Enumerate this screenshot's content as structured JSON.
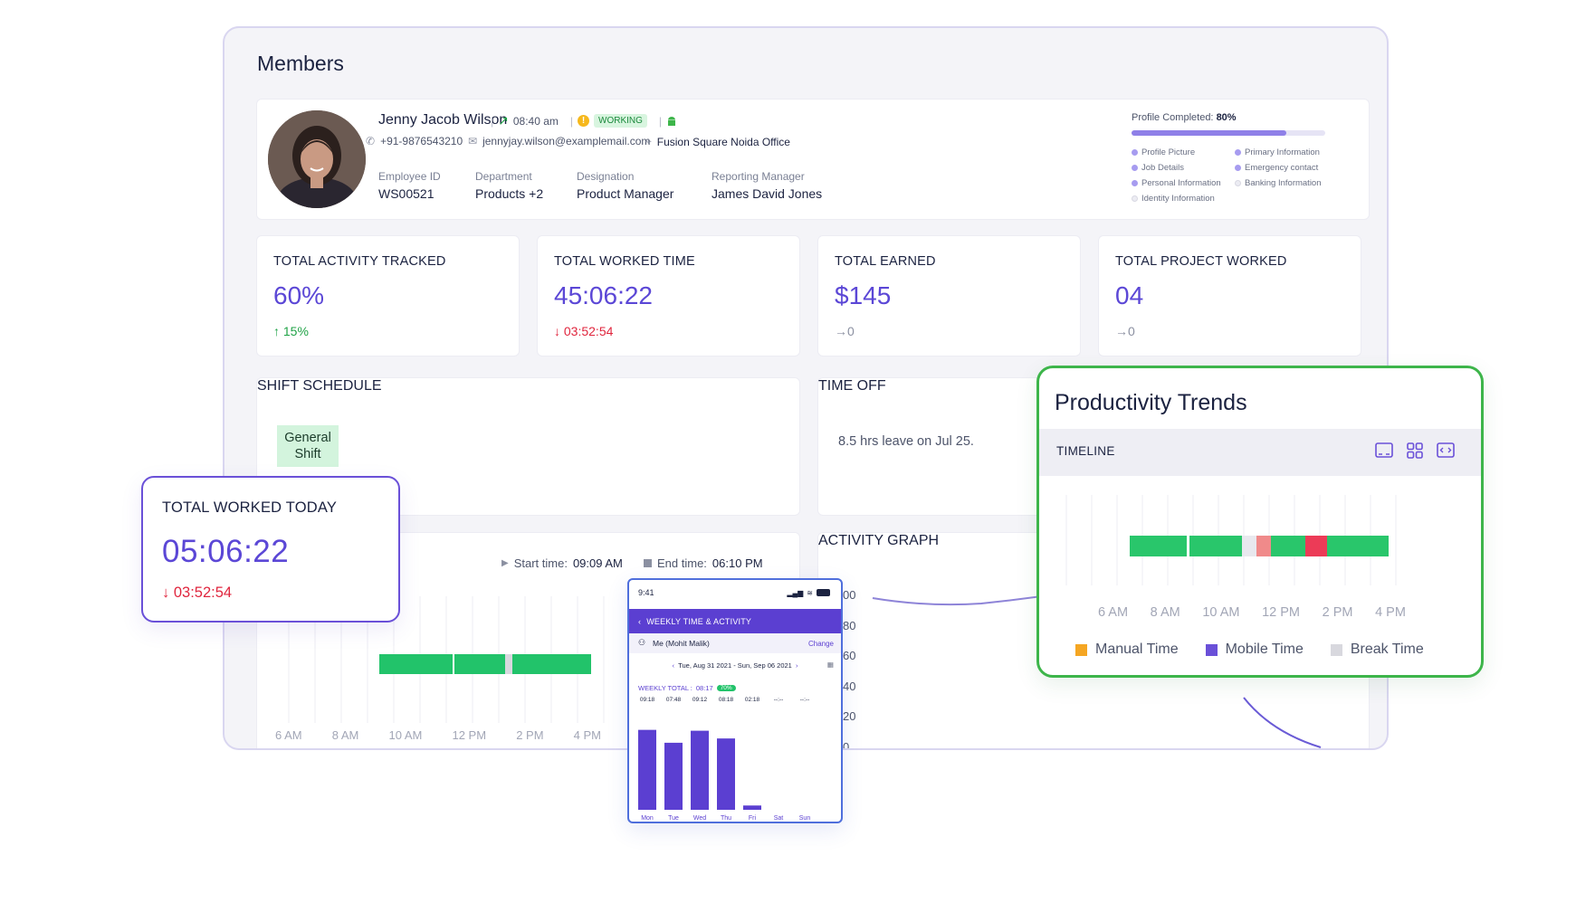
{
  "members": {
    "title": "Members"
  },
  "profile": {
    "name": "Jenny Jacob Wilson",
    "time": "08:40 am",
    "status": "WORKING",
    "phone": "+91-9876543210",
    "email": "jennyjay.wilson@examplemail.com",
    "office": "Fusion Square Noida Office",
    "fields": [
      {
        "label": "Employee ID",
        "value": "WS00521"
      },
      {
        "label": "Department",
        "value": "Products +2"
      },
      {
        "label": "Designation",
        "value": "Product Manager"
      },
      {
        "label": "Reporting Manager",
        "value": "James David Jones"
      }
    ],
    "completion": {
      "label": "Profile Completed:",
      "value": "80%",
      "fraction": 0.8,
      "items": [
        {
          "label": "Profile Picture",
          "done": true
        },
        {
          "label": "Primary Information",
          "done": true
        },
        {
          "label": "Job Details",
          "done": true
        },
        {
          "label": "Emergency contact",
          "done": true
        },
        {
          "label": "Personal Information",
          "done": true
        },
        {
          "label": "Banking Information",
          "done": false
        },
        {
          "label": "Identity Information",
          "done": false
        }
      ]
    }
  },
  "stats": [
    {
      "title": "TOTAL ACTIVITY TRACKED",
      "value": "60%",
      "change": "15%",
      "direction": "up"
    },
    {
      "title": "TOTAL WORKED TIME",
      "value": "45:06:22",
      "change": "03:52:54",
      "direction": "down"
    },
    {
      "title": "TOTAL EARNED",
      "value": "$145",
      "change": "0",
      "direction": "flat"
    },
    {
      "title": "TOTAL PROJECT WORKED",
      "value": "04",
      "change": "0",
      "direction": "flat"
    }
  ],
  "shift": {
    "title": "SHIFT SCHEDULE",
    "badge": "General Shift"
  },
  "timeoff": {
    "title": "TIME OFF",
    "text": "8.5 hrs leave on Jul 25."
  },
  "timeline": {
    "start_label": "Start time:",
    "start_value": "09:09 AM",
    "end_label": "End time:",
    "end_value": "06:10 PM",
    "ticks": [
      "6 AM",
      "8 AM",
      "10 AM",
      "12 PM",
      "2 PM",
      "4 PM"
    ]
  },
  "activity_graph": {
    "title": "ACTIVITY GRAPH",
    "y_ticks": [
      "00",
      "80",
      "60",
      "40",
      "20",
      "0"
    ]
  },
  "today": {
    "title": "TOTAL WORKED TODAY",
    "value": "05:06:22",
    "change": "03:52:54"
  },
  "productivity": {
    "title": "Productivity Trends",
    "timeline_label": "TIMELINE",
    "ticks": [
      "6 AM",
      "8 AM",
      "10 AM",
      "12 PM",
      "2 PM",
      "4 PM"
    ],
    "legend": [
      {
        "label": "Manual Time",
        "color": "#f5a623"
      },
      {
        "label": "Mobile Time",
        "color": "#6a50d8"
      },
      {
        "label": "Break Time",
        "color": "#d8d8de"
      }
    ]
  },
  "phone": {
    "clock": "9:41",
    "header": "WEEKLY TIME & ACTIVITY",
    "user": "Me (Mohit Malik)",
    "change": "Change",
    "range": "Tue, Aug 31 2021 - Sun, Sep 06 2021",
    "weekly_total_label": "WEEKLY TOTAL :",
    "weekly_total_value": "08:17",
    "weekly_badge": "70%",
    "bars": [
      {
        "day": "Mon",
        "label": "09:18",
        "value": 9.3
      },
      {
        "day": "Tue",
        "label": "07:48",
        "value": 7.8
      },
      {
        "day": "Wed",
        "label": "09:12",
        "value": 9.2
      },
      {
        "day": "Thu",
        "label": "08:18",
        "value": 8.3
      },
      {
        "day": "Fri",
        "label": "02:18",
        "value": 0.5
      },
      {
        "day": "Sat",
        "label": "--:--",
        "value": 0
      },
      {
        "day": "Sun",
        "label": "--:--",
        "value": 0
      }
    ]
  }
}
